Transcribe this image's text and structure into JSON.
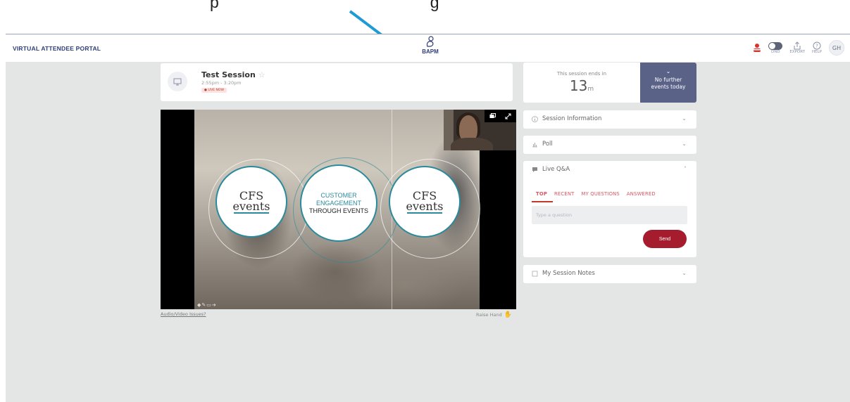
{
  "annotation": {
    "caption": "p",
    "caption_tail": "g",
    "arrow_color": "#1e9ad6"
  },
  "header": {
    "portal_title": "VIRTUAL ATTENDEE PORTAL",
    "logo_text": "BAPM",
    "dnd_label": "DND",
    "export_label": "EXPORT",
    "help_label": "HELP",
    "avatar_initials": "GH"
  },
  "session": {
    "title": "Test Session",
    "time": "2:55pm - 3:20pm",
    "badge": "● LIVE NOW"
  },
  "slide": {
    "left_logo": "CFS",
    "left_logo_sub": "events",
    "center_line1": "CUSTOMER",
    "center_line2": "ENGAGEMENT",
    "center_line3": "THROUGH EVENTS",
    "right_logo": "CFS",
    "right_logo_sub": "events"
  },
  "video_footer": {
    "av_issues": "Audio/Video Issues?",
    "raise_hand": "Raise Hand"
  },
  "timer": {
    "label": "This session ends in",
    "value": "13",
    "unit": "m"
  },
  "next_events": {
    "text_line1": "No further",
    "text_line2": "events today"
  },
  "panels": {
    "session_info": "Session Information",
    "poll": "Poll",
    "live_qa": "Live Q&A",
    "notes": "My Session Notes"
  },
  "qa": {
    "tabs": [
      "TOP",
      "RECENT",
      "MY QUESTIONS",
      "ANSWERED"
    ],
    "placeholder": "Type a question",
    "send": "Send"
  },
  "colors": {
    "accent": "#a61c2f",
    "navy": "#2f3d78",
    "purple_panel": "#5b6288",
    "teal": "#2a8a9b"
  }
}
